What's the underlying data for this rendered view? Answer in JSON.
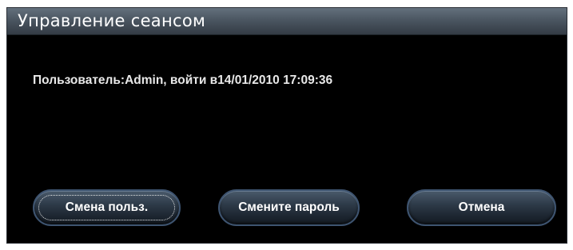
{
  "dialog": {
    "title": "Управление сеансом",
    "session_info": "Пользователь:Admin, войти в14/01/2010 17:09:36",
    "buttons": {
      "switch_user": "Смена польз.",
      "change_password": "Смените пароль",
      "cancel": "Отмена"
    },
    "focused_button": "switch_user"
  },
  "colors": {
    "background": "#000000",
    "titlebar": "#4b5661",
    "text": "#ffffff",
    "button_border": "#3e5470"
  }
}
